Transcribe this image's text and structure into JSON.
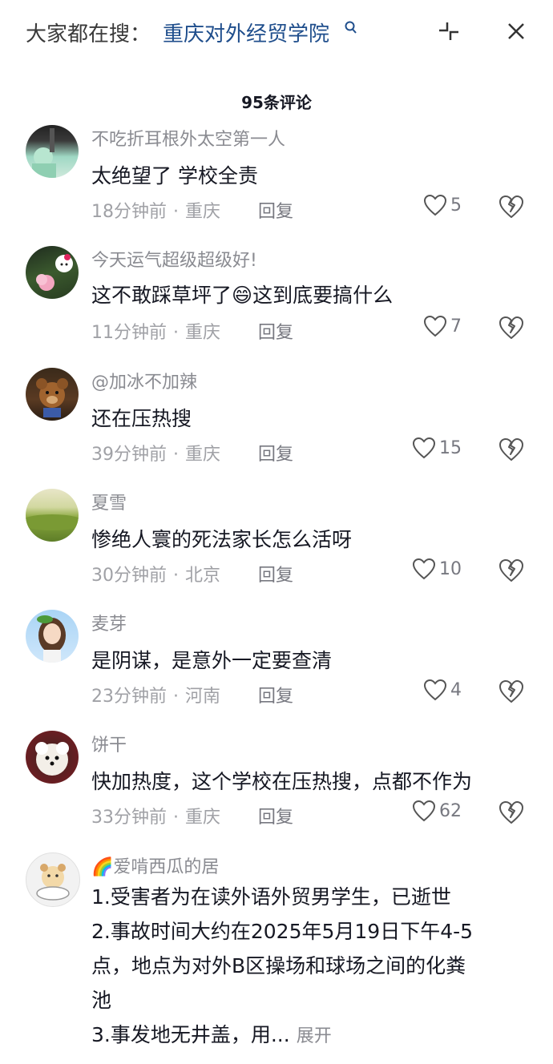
{
  "header": {
    "search_prefix": "大家都在搜：",
    "search_term": "重庆对外经贸学院",
    "comment_count": "95条评论"
  },
  "comments": [
    {
      "user": "不吃折耳根外太空第一人",
      "text": "太绝望了 学校全责",
      "time": "18分钟前",
      "location": "重庆",
      "reply": "回复",
      "likes": "5"
    },
    {
      "user": "今天运气超级超级好!",
      "text": "这不敢踩草坪了😄这到底要搞什么",
      "time": "11分钟前",
      "location": "重庆",
      "reply": "回复",
      "likes": "7"
    },
    {
      "user": "@加冰不加辣",
      "text": "还在压热搜",
      "time": "39分钟前",
      "location": "重庆",
      "reply": "回复",
      "likes": "15"
    },
    {
      "user": "夏雪",
      "text": "惨绝人寰的死法家长怎么活呀",
      "time": "30分钟前",
      "location": "北京",
      "reply": "回复",
      "likes": "10"
    },
    {
      "user": "麦芽",
      "text": "是阴谋，是意外一定要查清",
      "time": "23分钟前",
      "location": "河南",
      "reply": "回复",
      "likes": "4"
    },
    {
      "user": "饼干",
      "text": "快加热度，这个学校在压热搜，点都不作为",
      "time": "33分钟前",
      "location": "重庆",
      "reply": "回复",
      "likes": "62"
    }
  ],
  "last_comment": {
    "user": "🌈爱啃西瓜的居",
    "lines": [
      "1.受害者为在读外语外贸男学生，已逝世",
      "2.事故时间大约在2025年5月19日下午4-5",
      "点，地点为对外B区操场和球场之间的化粪",
      "池",
      "3.事发地无井盖，用..."
    ],
    "expand": "展开"
  }
}
